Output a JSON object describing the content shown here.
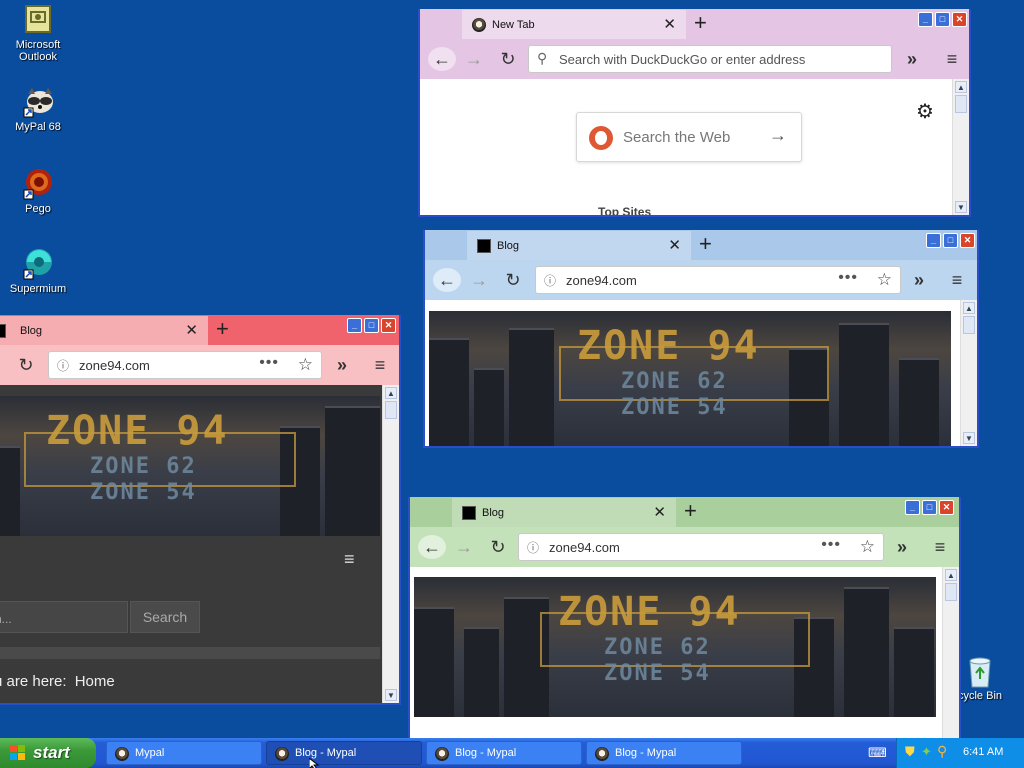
{
  "desktop_icons": [
    {
      "label": "Microsoft Outlook",
      "icon": "outlook-icon"
    },
    {
      "label": "MyPal 68",
      "icon": "mypal-icon"
    },
    {
      "label": "Pego",
      "icon": "pego-icon"
    },
    {
      "label": "Supermium",
      "icon": "supermium-icon"
    },
    {
      "label": "cycle Bin",
      "icon": "recycle-bin-icon"
    }
  ],
  "windows": {
    "newtab": {
      "tab_title": "New Tab",
      "url_placeholder": "Search with DuckDuckGo or enter address",
      "search_placeholder": "Search the Web",
      "top_sites_label": "Top Sites",
      "accent": "#e8c8e8"
    },
    "blue": {
      "tab_title": "Blog",
      "url": "zone94.com",
      "accent": "#aecbea"
    },
    "red": {
      "tab_title": "Blog",
      "url": "zone94.com",
      "search_placeholder": "h...",
      "search_button": "Search",
      "breadcrumb_prefix": "u are here:",
      "breadcrumb_home": "Home",
      "accent": "#f4a3a9"
    },
    "green": {
      "tab_title": "Blog",
      "url": "zone94.com",
      "accent": "#b8dcae"
    }
  },
  "banner": {
    "title": "ZONE 94",
    "line2": "ZONE 62",
    "line3": "ZONE 54"
  },
  "taskbar": {
    "start_label": "start",
    "tasks": [
      {
        "label": "Mypal",
        "active": false
      },
      {
        "label": "Blog - Mypal",
        "active": true
      },
      {
        "label": "Blog - Mypal",
        "active": false
      },
      {
        "label": "Blog - Mypal",
        "active": false
      }
    ],
    "clock": "6:41 AM"
  }
}
